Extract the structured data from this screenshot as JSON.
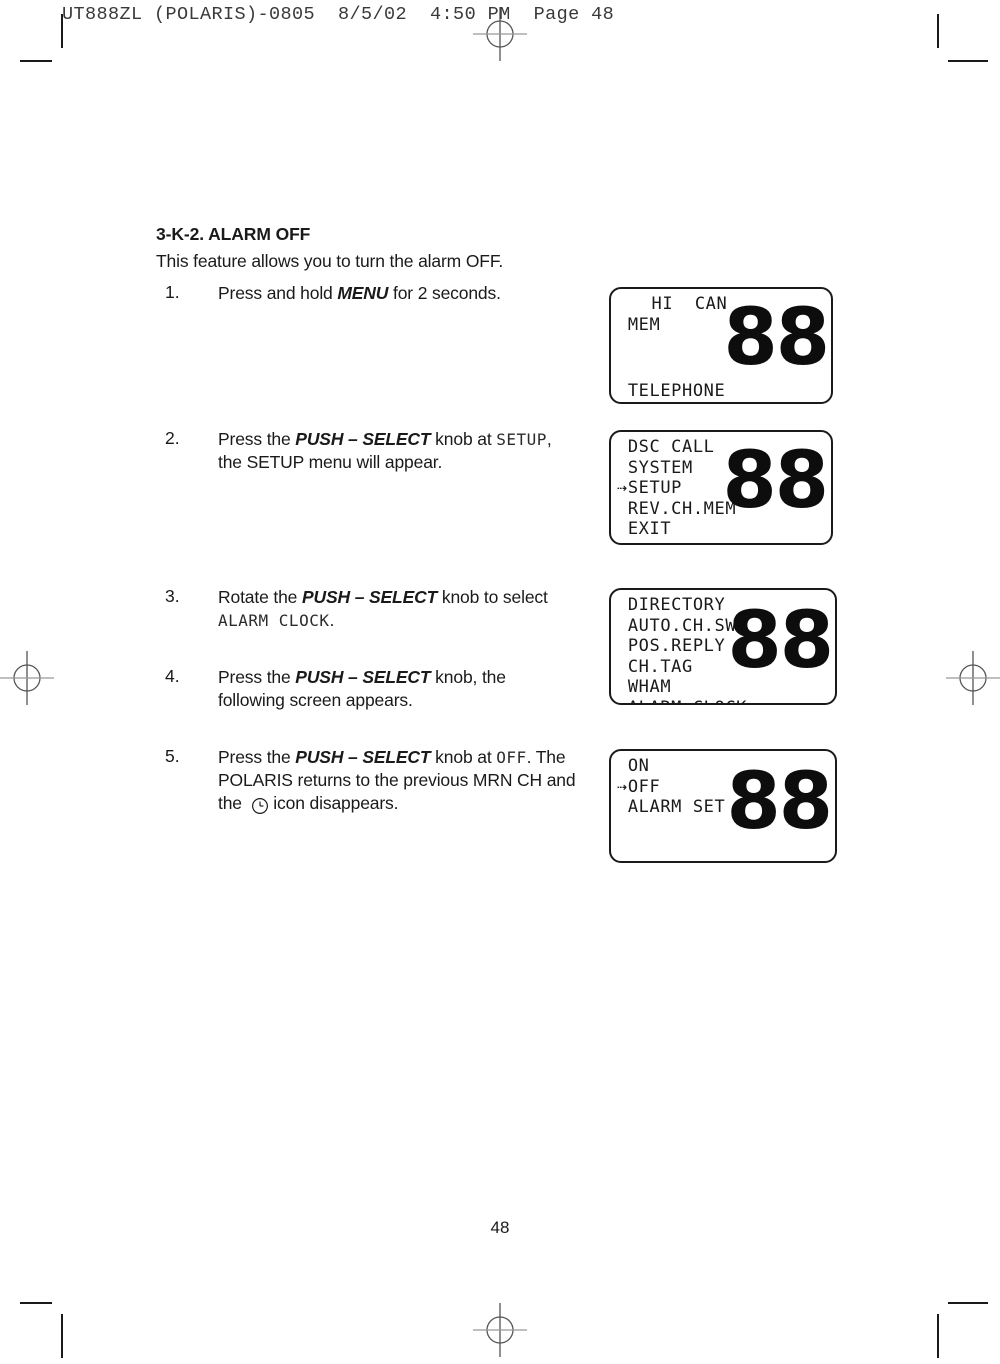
{
  "page": {
    "slug": "UT888ZL (POLARIS)-0805  8/5/02  4:50 PM  Page 48",
    "number": "48"
  },
  "section": {
    "title": "3-K-2. ALARM OFF",
    "intro": "This feature allows you to turn the alarm OFF."
  },
  "steps": [
    {
      "num": "1.",
      "parts": [
        {
          "type": "text",
          "value": "Press and hold "
        },
        {
          "type": "bold",
          "value": "MENU"
        },
        {
          "type": "text",
          "value": " for 2 seconds."
        }
      ]
    },
    {
      "num": "2.",
      "parts": [
        {
          "type": "text",
          "value": "Press the "
        },
        {
          "type": "bold",
          "value": "PUSH – SELECT"
        },
        {
          "type": "text",
          "value": " knob at "
        },
        {
          "type": "lcd",
          "value": "SETUP"
        },
        {
          "type": "text",
          "value": ", the SETUP menu will appear."
        }
      ]
    },
    {
      "num": "3.",
      "parts": [
        {
          "type": "text",
          "value": "Rotate the "
        },
        {
          "type": "bold",
          "value": "PUSH – SELECT"
        },
        {
          "type": "text",
          "value": " knob to select "
        },
        {
          "type": "lcd",
          "value": "ALARM CLOCK"
        },
        {
          "type": "text",
          "value": "."
        }
      ]
    },
    {
      "num": "4.",
      "parts": [
        {
          "type": "text",
          "value": "Press the "
        },
        {
          "type": "bold",
          "value": "PUSH – SELECT"
        },
        {
          "type": "text",
          "value": " knob, the following screen appears."
        }
      ]
    },
    {
      "num": "5.",
      "parts": [
        {
          "type": "text",
          "value": "Press the "
        },
        {
          "type": "bold",
          "value": "PUSH – SELECT"
        },
        {
          "type": "text",
          "value": " knob at "
        },
        {
          "type": "lcd",
          "value": "OFF"
        },
        {
          "type": "text",
          "value": ".  The POLARIS returns to the previous MRN CH and the "
        },
        {
          "type": "icon",
          "value": "clock-icon"
        },
        {
          "type": "text",
          "value": " icon disappears."
        }
      ]
    }
  ],
  "lcd_screens": [
    {
      "name": "lcd-screen-telephone",
      "big_digits": "88",
      "lines": [
        {
          "text": "HI  CAN",
          "align": "center",
          "cursor": false
        },
        {
          "text": "MEM",
          "align": "left",
          "cursor": false
        }
      ],
      "bottom_line": {
        "text": "TELEPHONE",
        "align": "left",
        "cursor": false
      }
    },
    {
      "name": "lcd-screen-menu",
      "big_digits": "88",
      "lines": [
        {
          "text": "DSC CALL",
          "align": "left",
          "cursor": false
        },
        {
          "text": "SYSTEM",
          "align": "left",
          "cursor": false
        },
        {
          "text": "SETUP",
          "align": "left",
          "cursor": true
        },
        {
          "text": "REV.CH.MEM",
          "align": "left",
          "cursor": false
        },
        {
          "text": "EXIT",
          "align": "left",
          "cursor": false
        }
      ]
    },
    {
      "name": "lcd-screen-setup-menu",
      "big_digits": "88",
      "lines": [
        {
          "text": "DIRECTORY",
          "align": "left",
          "cursor": false
        },
        {
          "text": "AUTO.CH.SW",
          "align": "left",
          "cursor": false
        },
        {
          "text": "POS.REPLY",
          "align": "left",
          "cursor": false
        },
        {
          "text": "CH.TAG",
          "align": "left",
          "cursor": false
        },
        {
          "text": "WHAM",
          "align": "left",
          "cursor": false
        },
        {
          "text": "ALARM CLOCK",
          "align": "left",
          "cursor": true
        }
      ]
    },
    {
      "name": "lcd-screen-alarm-onoff",
      "big_digits": "88",
      "lines": [
        {
          "text": "ON",
          "align": "left",
          "cursor": false
        },
        {
          "text": "OFF",
          "align": "left",
          "cursor": true
        },
        {
          "text": "ALARM SET",
          "align": "left",
          "cursor": false
        }
      ]
    }
  ]
}
